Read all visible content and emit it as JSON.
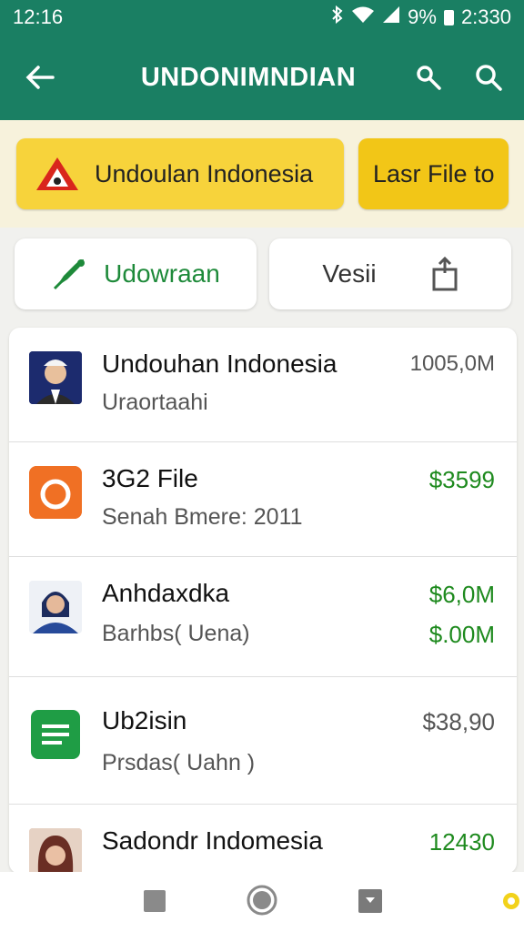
{
  "status_bar": {
    "time": "12:16",
    "battery": "9%",
    "clock_right": "2:330"
  },
  "app_bar": {
    "title": "UNDONIMNDIAN"
  },
  "chips": [
    {
      "label": "Undoulan Indonesia"
    },
    {
      "label": "Lasr File to"
    }
  ],
  "actions": [
    {
      "label": "Udowraan"
    },
    {
      "label": "Vesii"
    }
  ],
  "list": [
    {
      "name": "Undouhan Indonesia",
      "sub": "Uraortaahi",
      "value": "1005,0M",
      "value2": ""
    },
    {
      "name": "3G2 File",
      "sub": "Senah Bmere: 2011",
      "value": "$3599",
      "value2": ""
    },
    {
      "name": "Anhdaxdka",
      "sub": "Barhbs( Uena)",
      "value": "$6,0M",
      "value2": "$.00M"
    },
    {
      "name": "Ub2isin",
      "sub": "Prsdas( Uahn )",
      "value": "$38,90",
      "value2": ""
    },
    {
      "name": "Sadondr Indomesia",
      "sub": "",
      "value": "12430",
      "value2": ""
    }
  ],
  "colors": {
    "primary": "#1a7f63",
    "chip": "#f7d33b",
    "green_value": "#1e8a1e"
  }
}
